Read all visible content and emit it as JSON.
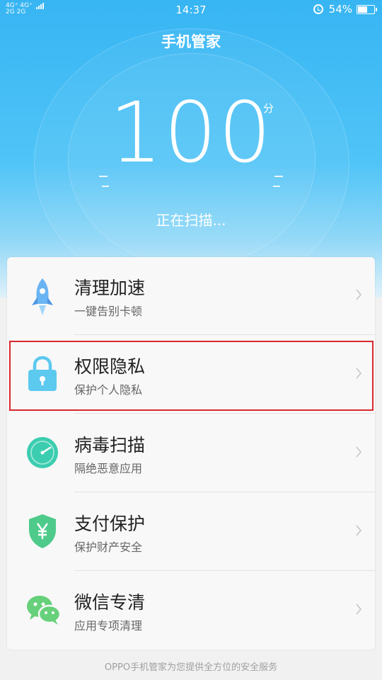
{
  "status_bar": {
    "network_left": "4G⁺ 4G⁺",
    "network_left2": "2G 2G",
    "time": "14:37",
    "battery": "54%",
    "battery_level": 0.54
  },
  "header": {
    "title": "手机管家"
  },
  "score": {
    "value": "100",
    "unit": "分",
    "status": "正在扫描..."
  },
  "items": [
    {
      "title": "清理加速",
      "subtitle": "一键告别卡顿",
      "icon": "rocket-icon",
      "color": "#5aa8f0"
    },
    {
      "title": "权限隐私",
      "subtitle": "保护个人隐私",
      "icon": "lock-icon",
      "color": "#5cc9ef"
    },
    {
      "title": "病毒扫描",
      "subtitle": "隔绝恶意应用",
      "icon": "gauge-icon",
      "color": "#3ccdb0"
    },
    {
      "title": "支付保护",
      "subtitle": "保护财产安全",
      "icon": "shield-yen-icon",
      "color": "#4ecb8a"
    },
    {
      "title": "微信专清",
      "subtitle": "应用专项清理",
      "icon": "wechat-icon",
      "color": "#66d07a"
    }
  ],
  "footer": {
    "text": "OPPO手机管家为您提供全方位的安全服务"
  }
}
